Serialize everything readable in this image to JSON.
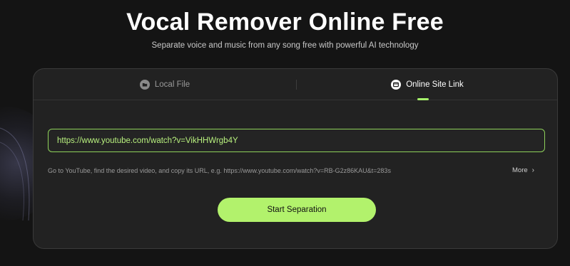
{
  "hero": {
    "title": "Vocal Remover Online Free",
    "subtitle": "Separate voice and music from any song free with powerful AI technology"
  },
  "tabs": [
    {
      "label": "Local File",
      "icon": "folder-icon",
      "active": false
    },
    {
      "label": "Online Site Link",
      "icon": "link-window-icon",
      "active": true
    }
  ],
  "url_input": {
    "value": "https://www.youtube.com/watch?v=VikHHWrgb4Y"
  },
  "hint": {
    "text": "Go to YouTube, find the desired video, and copy its URL, e.g. https://www.youtube.com/watch?v=RB-G2z86KAU&t=283s",
    "more_label": "More"
  },
  "start_button": {
    "label": "Start Separation"
  },
  "colors": {
    "background": "#141414",
    "card": "#222222",
    "accent": "#b2f26c",
    "input_border": "#8ed15a",
    "input_text": "#b8f07e"
  }
}
